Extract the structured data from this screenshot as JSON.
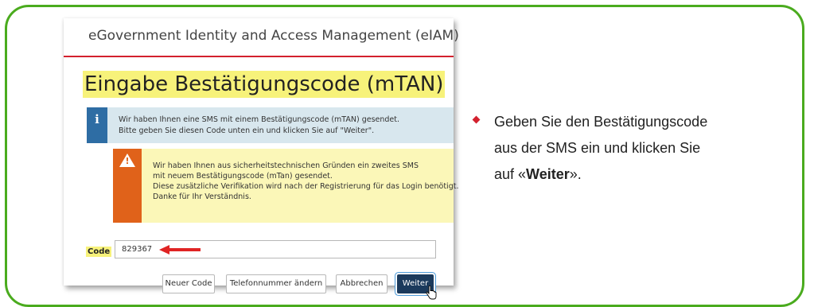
{
  "colors": {
    "frame_border": "#4aab1e",
    "accent_red": "#d3212e",
    "highlight_yellow": "#f7f27a",
    "info_blue": "#2e6da4",
    "info_bg": "#d8e7ee",
    "warning_orange": "#e0621a",
    "warning_bg": "#fbf7b8",
    "primary_button": "#1b3a5c"
  },
  "app": {
    "title": "eGovernment Identity and Access Management (eIAM)"
  },
  "page": {
    "title": "Eingabe Bestätigungscode (mTAN)"
  },
  "info": {
    "icon": "info-icon",
    "icon_glyph": "i",
    "line1": "Wir haben Ihnen eine SMS mit einem Bestätigungscode (mTAN) gesendet.",
    "line2": "Bitte geben Sie diesen Code unten ein und klicken Sie auf \"Weiter\"."
  },
  "warning": {
    "icon": "warning-icon",
    "icon_glyph": "!",
    "line1": "Wir haben Ihnen aus sicherheitstechnischen Gründen ein zweites SMS",
    "line2": "mit neuem Bestätigungscode (mTan)  gesendet.",
    "line3": "Diese zusätzliche Verifikation wird nach der Registrierung für das Login benötigt.",
    "line4": "Danke für Ihr Verständnis."
  },
  "form": {
    "code_label": "Code",
    "code_value": "829367"
  },
  "buttons": {
    "new_code": "Neuer Code",
    "change_phone": "Telefonnummer ändern",
    "cancel": "Abbrechen",
    "next": "Weiter"
  },
  "instruction": {
    "line1": "Geben Sie den Bestätigungscode",
    "line2": "aus der SMS ein und klicken Sie",
    "line3_prefix": "auf «",
    "line3_bold": "Weiter",
    "line3_suffix": "»."
  }
}
